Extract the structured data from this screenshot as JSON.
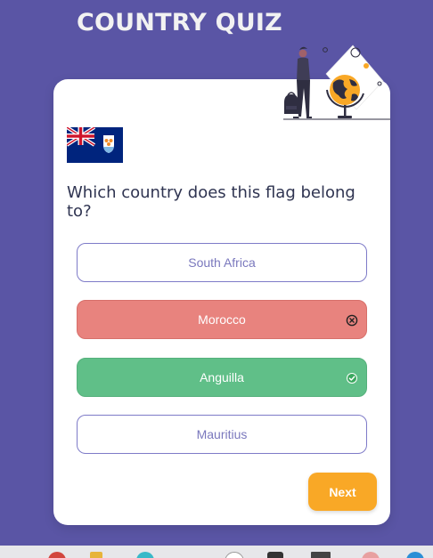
{
  "app": {
    "title": "COUNTRY QUIZ"
  },
  "quiz": {
    "question": "Which country does this flag belong to?",
    "flag_icon": "anguilla-flag-icon",
    "options": [
      {
        "label": "South Africa",
        "state": "neutral"
      },
      {
        "label": "Morocco",
        "state": "wrong",
        "icon": "close-circle-icon"
      },
      {
        "label": "Anguilla",
        "state": "correct",
        "icon": "check-circle-icon"
      },
      {
        "label": "Mauritius",
        "state": "neutral"
      }
    ],
    "next_label": "Next"
  },
  "colors": {
    "background": "#5a55a5",
    "accent": "#f9a826",
    "correct": "#60bf88",
    "wrong": "#e8837e",
    "neutral_border": "#7e7bc8"
  }
}
